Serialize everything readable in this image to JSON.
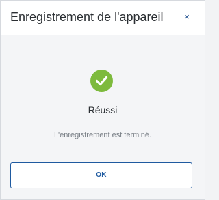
{
  "dialog": {
    "title": "Enregistrement de l'appareil",
    "close_symbol": "×",
    "status_icon": "checkmark-circle-icon",
    "status_title": "Réussi",
    "message": "L'enregistrement est terminé.",
    "ok_label": "OK"
  },
  "colors": {
    "success": "#7dba3d",
    "accent": "#1f5aa0",
    "title_text": "#2b2f33",
    "muted_text": "#7a8087",
    "body_background": "#f4f5f7",
    "header_background": "#ffffff"
  }
}
